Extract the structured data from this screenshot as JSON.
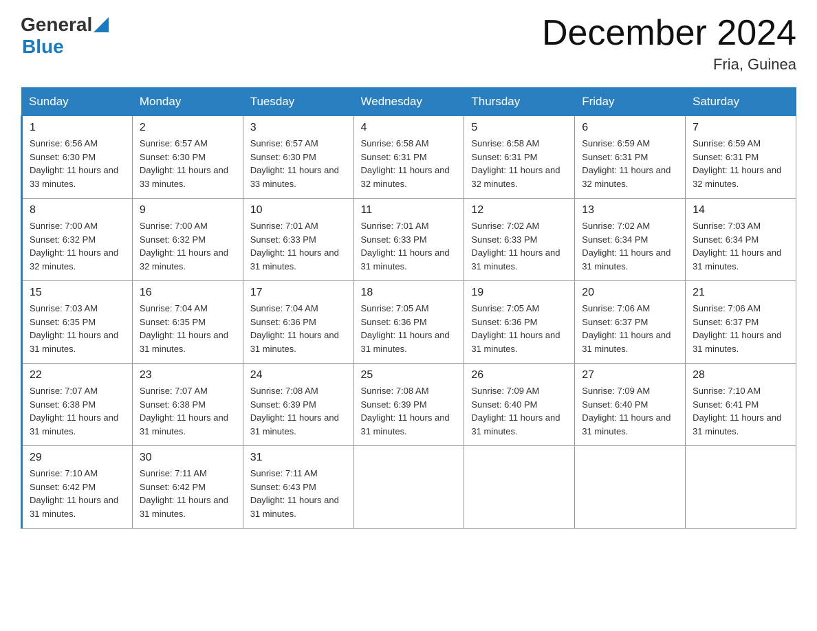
{
  "header": {
    "logo_general": "General",
    "logo_blue": "Blue",
    "month_title": "December 2024",
    "location": "Fria, Guinea"
  },
  "days_of_week": [
    "Sunday",
    "Monday",
    "Tuesday",
    "Wednesday",
    "Thursday",
    "Friday",
    "Saturday"
  ],
  "weeks": [
    [
      {
        "day": "1",
        "sunrise": "6:56 AM",
        "sunset": "6:30 PM",
        "daylight": "11 hours and 33 minutes."
      },
      {
        "day": "2",
        "sunrise": "6:57 AM",
        "sunset": "6:30 PM",
        "daylight": "11 hours and 33 minutes."
      },
      {
        "day": "3",
        "sunrise": "6:57 AM",
        "sunset": "6:30 PM",
        "daylight": "11 hours and 33 minutes."
      },
      {
        "day": "4",
        "sunrise": "6:58 AM",
        "sunset": "6:31 PM",
        "daylight": "11 hours and 32 minutes."
      },
      {
        "day": "5",
        "sunrise": "6:58 AM",
        "sunset": "6:31 PM",
        "daylight": "11 hours and 32 minutes."
      },
      {
        "day": "6",
        "sunrise": "6:59 AM",
        "sunset": "6:31 PM",
        "daylight": "11 hours and 32 minutes."
      },
      {
        "day": "7",
        "sunrise": "6:59 AM",
        "sunset": "6:31 PM",
        "daylight": "11 hours and 32 minutes."
      }
    ],
    [
      {
        "day": "8",
        "sunrise": "7:00 AM",
        "sunset": "6:32 PM",
        "daylight": "11 hours and 32 minutes."
      },
      {
        "day": "9",
        "sunrise": "7:00 AM",
        "sunset": "6:32 PM",
        "daylight": "11 hours and 32 minutes."
      },
      {
        "day": "10",
        "sunrise": "7:01 AM",
        "sunset": "6:33 PM",
        "daylight": "11 hours and 31 minutes."
      },
      {
        "day": "11",
        "sunrise": "7:01 AM",
        "sunset": "6:33 PM",
        "daylight": "11 hours and 31 minutes."
      },
      {
        "day": "12",
        "sunrise": "7:02 AM",
        "sunset": "6:33 PM",
        "daylight": "11 hours and 31 minutes."
      },
      {
        "day": "13",
        "sunrise": "7:02 AM",
        "sunset": "6:34 PM",
        "daylight": "11 hours and 31 minutes."
      },
      {
        "day": "14",
        "sunrise": "7:03 AM",
        "sunset": "6:34 PM",
        "daylight": "11 hours and 31 minutes."
      }
    ],
    [
      {
        "day": "15",
        "sunrise": "7:03 AM",
        "sunset": "6:35 PM",
        "daylight": "11 hours and 31 minutes."
      },
      {
        "day": "16",
        "sunrise": "7:04 AM",
        "sunset": "6:35 PM",
        "daylight": "11 hours and 31 minutes."
      },
      {
        "day": "17",
        "sunrise": "7:04 AM",
        "sunset": "6:36 PM",
        "daylight": "11 hours and 31 minutes."
      },
      {
        "day": "18",
        "sunrise": "7:05 AM",
        "sunset": "6:36 PM",
        "daylight": "11 hours and 31 minutes."
      },
      {
        "day": "19",
        "sunrise": "7:05 AM",
        "sunset": "6:36 PM",
        "daylight": "11 hours and 31 minutes."
      },
      {
        "day": "20",
        "sunrise": "7:06 AM",
        "sunset": "6:37 PM",
        "daylight": "11 hours and 31 minutes."
      },
      {
        "day": "21",
        "sunrise": "7:06 AM",
        "sunset": "6:37 PM",
        "daylight": "11 hours and 31 minutes."
      }
    ],
    [
      {
        "day": "22",
        "sunrise": "7:07 AM",
        "sunset": "6:38 PM",
        "daylight": "11 hours and 31 minutes."
      },
      {
        "day": "23",
        "sunrise": "7:07 AM",
        "sunset": "6:38 PM",
        "daylight": "11 hours and 31 minutes."
      },
      {
        "day": "24",
        "sunrise": "7:08 AM",
        "sunset": "6:39 PM",
        "daylight": "11 hours and 31 minutes."
      },
      {
        "day": "25",
        "sunrise": "7:08 AM",
        "sunset": "6:39 PM",
        "daylight": "11 hours and 31 minutes."
      },
      {
        "day": "26",
        "sunrise": "7:09 AM",
        "sunset": "6:40 PM",
        "daylight": "11 hours and 31 minutes."
      },
      {
        "day": "27",
        "sunrise": "7:09 AM",
        "sunset": "6:40 PM",
        "daylight": "11 hours and 31 minutes."
      },
      {
        "day": "28",
        "sunrise": "7:10 AM",
        "sunset": "6:41 PM",
        "daylight": "11 hours and 31 minutes."
      }
    ],
    [
      {
        "day": "29",
        "sunrise": "7:10 AM",
        "sunset": "6:42 PM",
        "daylight": "11 hours and 31 minutes."
      },
      {
        "day": "30",
        "sunrise": "7:11 AM",
        "sunset": "6:42 PM",
        "daylight": "11 hours and 31 minutes."
      },
      {
        "day": "31",
        "sunrise": "7:11 AM",
        "sunset": "6:43 PM",
        "daylight": "11 hours and 31 minutes."
      },
      null,
      null,
      null,
      null
    ]
  ]
}
